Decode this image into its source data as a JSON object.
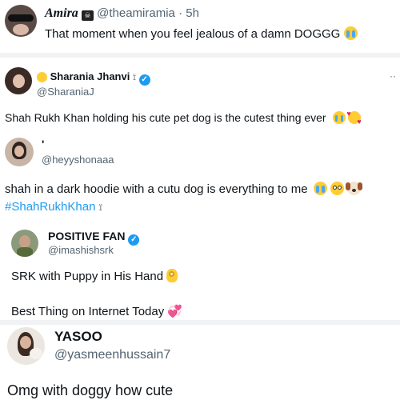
{
  "tweet1": {
    "name": "Amira",
    "name_icon": "pirate-flag-icon",
    "handle": "@theamiramia",
    "separator": "·",
    "time": "5h",
    "text": "That moment when you feel jealous of a damn DOGGG",
    "emoji": "loudly-crying-face-icon"
  },
  "tweet2": {
    "name": "Sharania Jhanvi",
    "badge_icon": "verified-badge-icon",
    "handle": "@SharaniaJ",
    "more": "··",
    "text": "Shah Rukh Khan holding his cute pet dog is the cutest thing ever",
    "emojis": [
      "loudly-crying-face-icon",
      "smiling-face-with-hearts-icon"
    ]
  },
  "tweet3": {
    "name": "'",
    "handle": "@heyyshonaaa",
    "text": "shah in a dark hoodie with a cutu dog is everything to me",
    "emojis": [
      "loudly-crying-face-icon",
      "pleading-face-icon",
      "dog-face-icon"
    ],
    "hashtag": "#ShahRukhKhan"
  },
  "tweet4": {
    "name": "POSITIVE FAN",
    "badge_icon": "verified-badge-icon",
    "handle": "@imashishsrk",
    "text_line1": "SRK with Puppy in His Hand",
    "emoji_line1": "ok-hand-icon",
    "text_line2": "Best Thing on Internet Today",
    "emoji_line2": "heart-with-ribbon-icon"
  },
  "tweet5": {
    "name": "YASOO",
    "handle": "@yasmeenhussain7",
    "text": "Omg with doggy how cute"
  },
  "colors": {
    "accent": "#1d9bf0",
    "text": "#0f1419",
    "muted": "#536471",
    "emoji_yellow": "#ffcc33"
  }
}
